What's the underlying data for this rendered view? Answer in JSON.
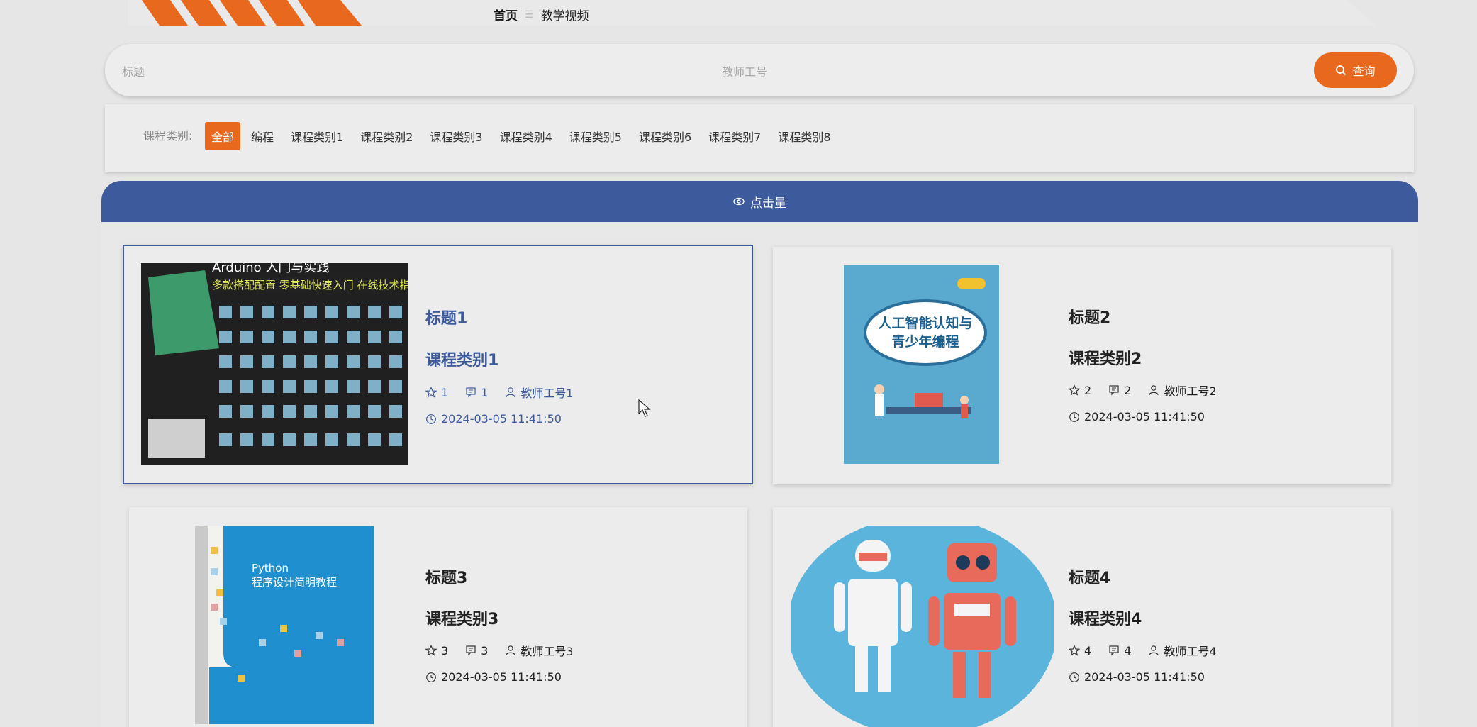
{
  "nav": {
    "home": "首页",
    "separator": "☰",
    "current": "教学视频"
  },
  "search": {
    "title_placeholder": "标题",
    "teacher_placeholder": "教师工号",
    "button_label": "查询",
    "button_color": "#e8691d"
  },
  "filter": {
    "label": "课程类别:",
    "categories": [
      "全部",
      "编程",
      "课程类别1",
      "课程类别2",
      "课程类别3",
      "课程类别4",
      "课程类别5",
      "课程类别6",
      "课程类别7",
      "课程类别8"
    ],
    "active": "全部"
  },
  "sort": {
    "label": "点击量",
    "icon": "eye-icon"
  },
  "accent": "#3c5a9c",
  "cards": [
    {
      "title": "标题1",
      "category": "课程类别1",
      "likes": "1",
      "comments": "1",
      "teacher": "教师工号1",
      "time": "2024-03-05 11:41:50",
      "image": "arduino-kit-cover",
      "selected": true
    },
    {
      "title": "标题2",
      "category": "课程类别2",
      "likes": "2",
      "comments": "2",
      "teacher": "教师工号2",
      "time": "2024-03-05 11:41:50",
      "image": "ai-book-cover",
      "selected": false
    },
    {
      "title": "标题3",
      "category": "课程类别3",
      "likes": "3",
      "comments": "3",
      "teacher": "教师工号3",
      "time": "2024-03-05 11:41:50",
      "image": "python-book-cover",
      "selected": false
    },
    {
      "title": "标题4",
      "category": "课程类别4",
      "likes": "4",
      "comments": "4",
      "teacher": "教师工号4",
      "time": "2024-03-05 11:41:50",
      "image": "robots-illustration",
      "selected": false
    }
  ],
  "thumb_text": {
    "card1_line1": "Arduino 入门与实践",
    "card1_line2": "多款搭配配置 零基础快速入门 在线技术指导",
    "card2_title1": "人工智能认知与",
    "card2_title2": "青少年编程",
    "card3_title1": "Python",
    "card3_title2": "程序设计简明教程"
  }
}
